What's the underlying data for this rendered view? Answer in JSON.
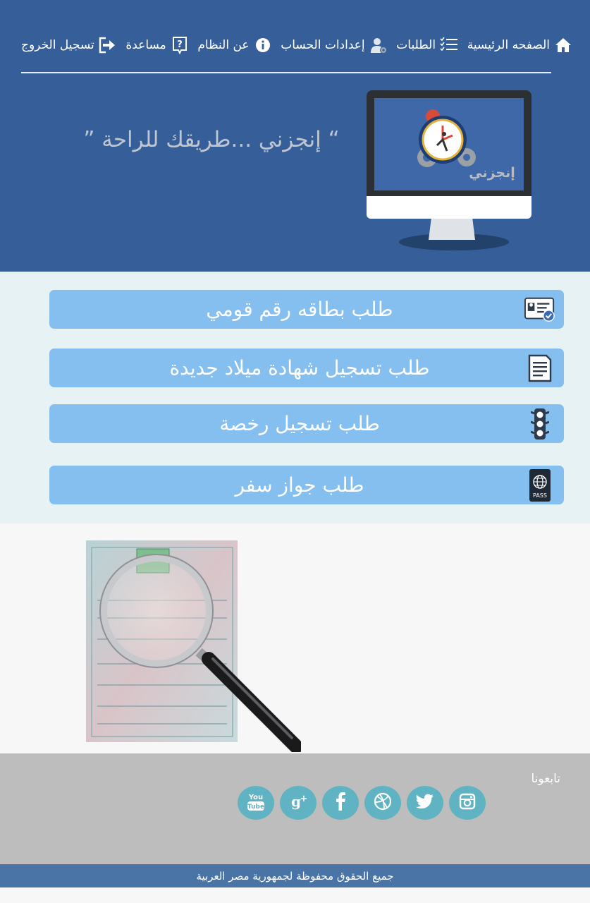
{
  "nav": {
    "home": "الصفحه الرئيسية",
    "requests": "الطلبات",
    "account_settings": "إعدادات الحساب",
    "about": "عن النظام",
    "help": "مساعدة",
    "logout": "تسجيل الخروج"
  },
  "hero": {
    "slogan": "“ إنجزني ...طريقك للراحة ”",
    "logo_text": "إنجزني"
  },
  "services": [
    {
      "label": "طلب بطاقه رقم قومي",
      "icon": "id-card-icon"
    },
    {
      "label": "طلب تسجيل شهادة ميلاد جديدة",
      "icon": "document-icon"
    },
    {
      "label": "طلب تسجيل رخصة",
      "icon": "traffic-light-icon"
    },
    {
      "label": "طلب جواز سفر",
      "icon": "passport-icon",
      "icon_text": "PASS"
    }
  ],
  "footer": {
    "follow_label": "تابعونا",
    "socials": [
      "youtube-icon",
      "google-plus-icon",
      "facebook-icon",
      "dribbble-icon",
      "twitter-icon",
      "instagram-icon"
    ],
    "copyright": "جميع الحقوق محفوظة لجمهورية مصر العربية"
  },
  "colors": {
    "header_bg": "#365f9a",
    "service_button": "#85bff0",
    "services_bg": "#e6f2f4",
    "social_circle": "#5fb3c2",
    "footer_bg": "#bdbdbd",
    "copyright_bar": "#4a74a6"
  }
}
